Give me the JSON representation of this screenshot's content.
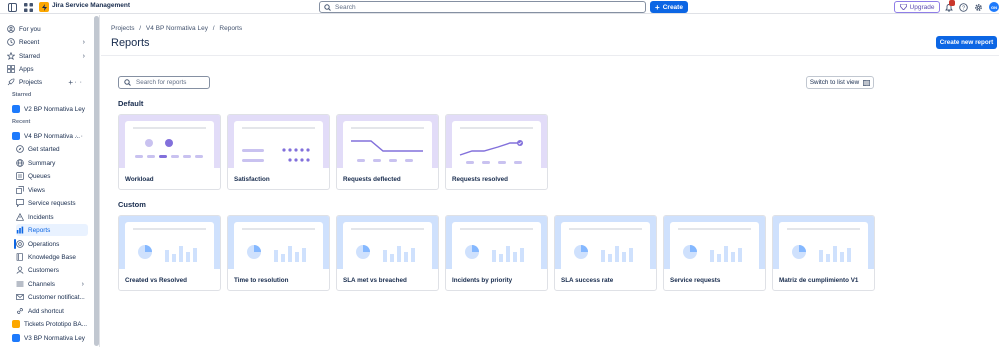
{
  "app": {
    "name": "Jira Service Management"
  },
  "topbar": {
    "search_placeholder": "Search",
    "create_label": "Create",
    "upgrade_label": "Upgrade",
    "notification_count": "",
    "avatar_initials": "GN"
  },
  "sidebar": {
    "top_items": [
      {
        "label": "For you"
      },
      {
        "label": "Recent"
      },
      {
        "label": "Starred"
      },
      {
        "label": "Apps"
      },
      {
        "label": "Projects"
      }
    ],
    "starred_label": "Starred",
    "recent_label": "Recent",
    "starred_projects": [
      {
        "label": "V2 BP Normativa Ley"
      }
    ],
    "current_project": {
      "label": "V4 BP Normativa ..."
    },
    "project_items": [
      {
        "label": "Get started"
      },
      {
        "label": "Summary"
      },
      {
        "label": "Queues"
      },
      {
        "label": "Views"
      },
      {
        "label": "Service requests"
      },
      {
        "label": "Incidents"
      },
      {
        "label": "Reports"
      },
      {
        "label": "Operations"
      },
      {
        "label": "Knowledge Base"
      },
      {
        "label": "Customers"
      },
      {
        "label": "Channels"
      },
      {
        "label": "Customer notificat..."
      },
      {
        "label": "Add shortcut"
      }
    ],
    "other_projects": [
      {
        "label": "Tickets Prototipo BA..."
      },
      {
        "label": "V3 BP Normativa Ley"
      }
    ]
  },
  "main": {
    "breadcrumb": [
      "Projects",
      "/",
      "V4 BP Normativa Ley",
      "/",
      "Reports"
    ],
    "title": "Reports",
    "create_report_label": "Create new report",
    "search_placeholder": "Search for reports",
    "switch_view_label": "Switch to list view",
    "default_section": {
      "title": "Default",
      "cards": [
        {
          "label": "Workload"
        },
        {
          "label": "Satisfaction"
        },
        {
          "label": "Requests deflected"
        },
        {
          "label": "Requests resolved"
        }
      ]
    },
    "custom_section": {
      "title": "Custom",
      "cards": [
        {
          "label": "Created vs Resolved"
        },
        {
          "label": "Time to resolution"
        },
        {
          "label": "SLA met vs breached"
        },
        {
          "label": "Incidents by priority"
        },
        {
          "label": "SLA success rate"
        },
        {
          "label": "Service requests"
        },
        {
          "label": "Matriz de cumplimiento V1"
        }
      ]
    }
  },
  "colors": {
    "brand_blue": "#0c66e4",
    "default_thumb": "#e2dcf8",
    "custom_thumb": "#cfe1fd",
    "accent_purple": "#8270db"
  }
}
